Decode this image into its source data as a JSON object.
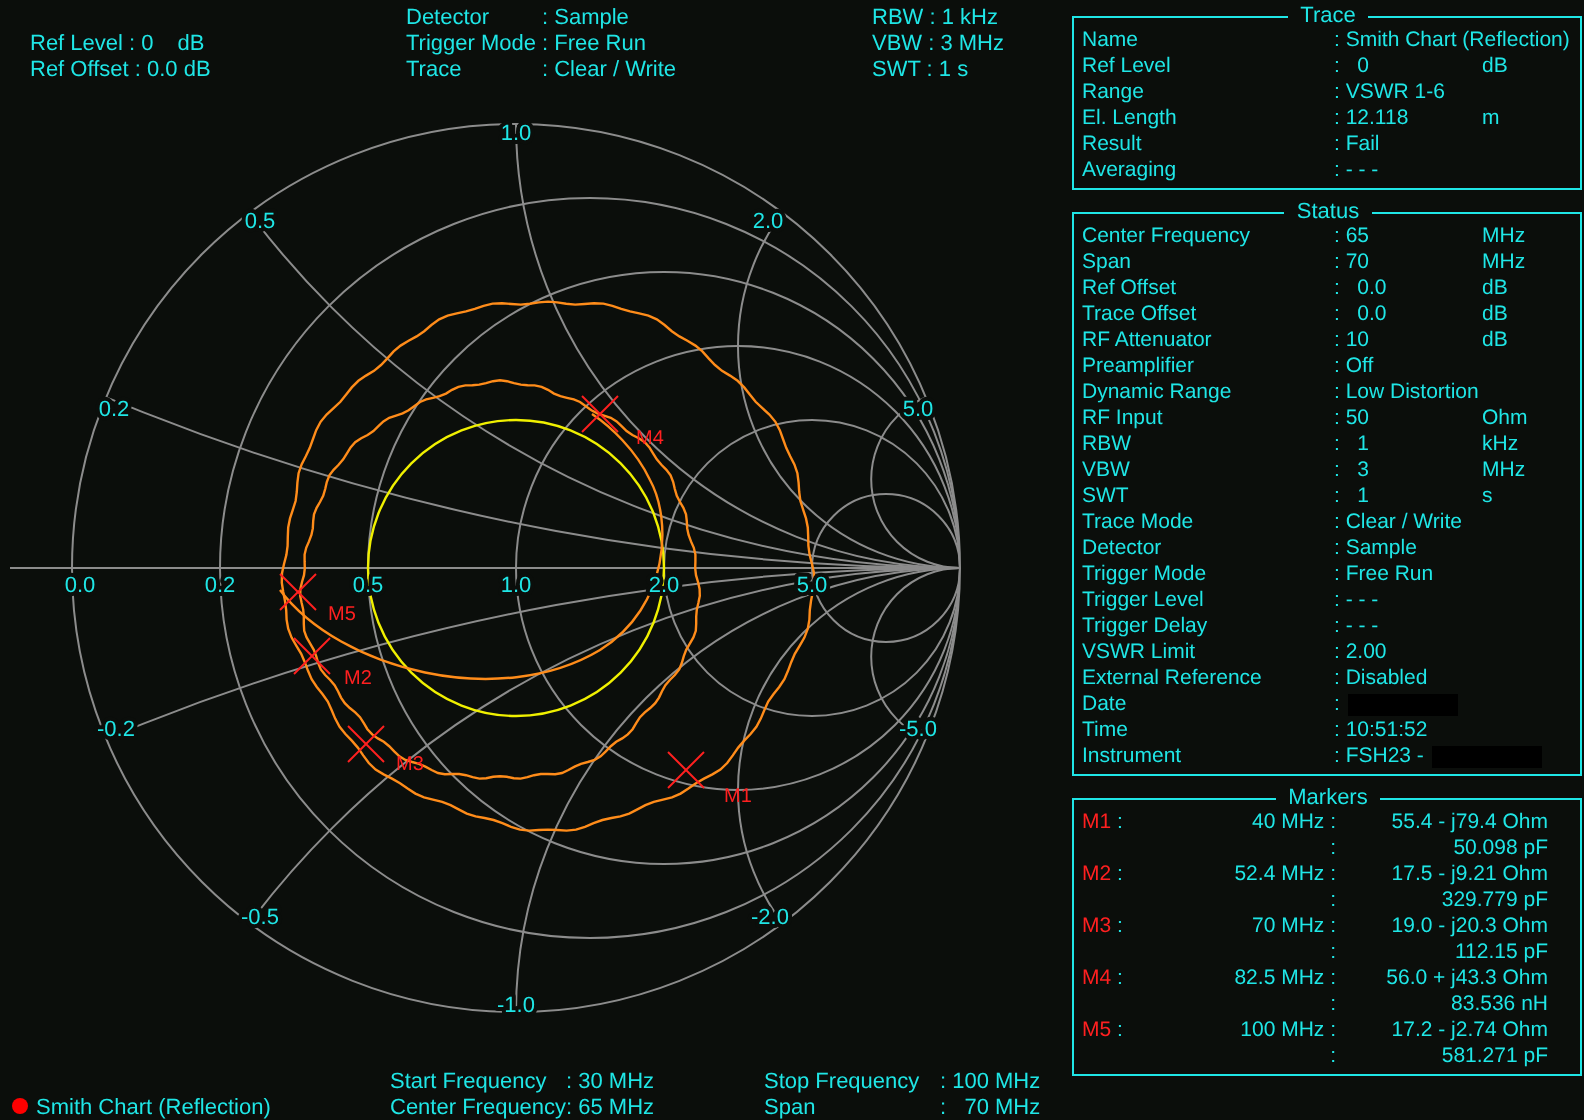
{
  "header": {
    "left": [
      {
        "text": "Ref Level : 0",
        "unit": "dB"
      },
      {
        "text": "Ref Offset : 0.0 dB"
      }
    ],
    "middle": [
      {
        "label": "Detector",
        "value": ": Sample"
      },
      {
        "label": "Trigger Mode",
        "value": ": Free Run"
      },
      {
        "label": "Trace",
        "value": ": Clear / Write"
      }
    ],
    "right": [
      "RBW : 1 kHz",
      "VBW : 3 MHz",
      "SWT : 1 s"
    ]
  },
  "chart": {
    "resistance_labels": [
      "0.0",
      "0.2",
      "0.5",
      "1.0",
      "2.0",
      "5.0"
    ],
    "reactance_labels": [
      "1.0",
      "0.5",
      "0.2",
      "2.0",
      "5.0",
      "-0.2",
      "-0.5",
      "-1.0",
      "-2.0",
      "-5.0"
    ],
    "markers": [
      {
        "label": "M1"
      },
      {
        "label": "M2"
      },
      {
        "label": "M3"
      },
      {
        "label": "M4"
      },
      {
        "label": "M5"
      }
    ]
  },
  "trace_panel": {
    "title": "Trace",
    "rows": [
      {
        "label": "Name",
        "value": ": Smith Chart (Reflection)"
      },
      {
        "label": "Ref Level",
        "value": ":   0",
        "unit": "dB"
      },
      {
        "label": "Range",
        "value": ": VSWR 1-6"
      },
      {
        "label": "El. Length",
        "value": ": 12.118",
        "unit": "m"
      },
      {
        "label": "Result",
        "value": ": Fail"
      },
      {
        "label": "Averaging",
        "value": ": - - -"
      }
    ]
  },
  "status_panel": {
    "title": "Status",
    "rows": [
      {
        "label": "Center Frequency",
        "value": ": 65",
        "unit": "MHz",
        "redacted": false
      },
      {
        "label": "Span",
        "value": ": 70",
        "unit": "MHz",
        "redacted": false
      },
      {
        "label": "Ref Offset",
        "value": ":   0.0",
        "unit": "dB",
        "redacted": false
      },
      {
        "label": "Trace Offset",
        "value": ":   0.0",
        "unit": "dB",
        "redacted": false
      },
      {
        "label": "RF Attenuator",
        "value": ": 10",
        "unit": "dB",
        "redacted": false
      },
      {
        "label": "Preamplifier",
        "value": ": Off",
        "redacted": false
      },
      {
        "label": "Dynamic Range",
        "value": ": Low Distortion",
        "redacted": false
      },
      {
        "label": "RF Input",
        "value": ": 50",
        "unit": "Ohm",
        "redacted": false
      },
      {
        "label": "RBW",
        "value": ":   1",
        "unit": "kHz",
        "redacted": false
      },
      {
        "label": "VBW",
        "value": ":   3",
        "unit": "MHz",
        "redacted": false
      },
      {
        "label": "SWT",
        "value": ":   1",
        "unit": "s",
        "redacted": false
      },
      {
        "label": "Trace Mode",
        "value": ": Clear / Write",
        "redacted": false
      },
      {
        "label": "Detector",
        "value": ": Sample",
        "redacted": false
      },
      {
        "label": "Trigger Mode",
        "value": ": Free Run",
        "redacted": false
      },
      {
        "label": "Trigger Level",
        "value": ": - - -",
        "redacted": false
      },
      {
        "label": "Trigger Delay",
        "value": ": - - -",
        "redacted": false
      },
      {
        "label": "VSWR Limit",
        "value": ": 2.00",
        "redacted": false
      },
      {
        "label": "External Reference",
        "value": ": Disabled",
        "redacted": false
      },
      {
        "label": "Date",
        "value": ":",
        "redacted": true
      },
      {
        "label": "Time",
        "value": ": 10:51:52",
        "redacted": false
      },
      {
        "label": "Instrument",
        "value": ": FSH23 -",
        "redacted": true
      }
    ]
  },
  "markers_panel": {
    "title": "Markers",
    "rows": [
      {
        "name": "M1",
        "name_sep": ":",
        "frequency": "40 MHz :",
        "impedance": "55.4 - j79.4 Ohm",
        "equivalent_sep": ":",
        "equivalent": "50.098 pF"
      },
      {
        "name": "M2",
        "name_sep": ":",
        "frequency": "52.4 MHz :",
        "impedance": "17.5 - j9.21 Ohm",
        "equivalent_sep": ":",
        "equivalent": "329.779 pF"
      },
      {
        "name": "M3",
        "name_sep": ":",
        "frequency": "70 MHz :",
        "impedance": "19.0 - j20.3 Ohm",
        "equivalent_sep": ":",
        "equivalent": "112.15 pF"
      },
      {
        "name": "M4",
        "name_sep": ":",
        "frequency": "82.5 MHz :",
        "impedance": "56.0 + j43.3 Ohm",
        "equivalent_sep": ":",
        "equivalent": "83.536 nH"
      },
      {
        "name": "M5",
        "name_sep": ":",
        "frequency": "100 MHz :",
        "impedance": "17.2 - j2.74 Ohm",
        "equivalent_sep": ":",
        "equivalent": "581.271 pF"
      }
    ]
  },
  "footer": {
    "legend": {
      "label": "Smith Chart (Reflection)",
      "color": "#ff0000"
    },
    "middle": [
      {
        "label": "Start Frequency",
        "value": ": 30 MHz"
      },
      {
        "label": "Center Frequency",
        "value": ": 65 MHz"
      }
    ],
    "right": [
      {
        "label": "Stop Frequency",
        "value": ": 100 MHz"
      },
      {
        "label": "Span",
        "value": ":   70 MHz"
      }
    ]
  }
}
